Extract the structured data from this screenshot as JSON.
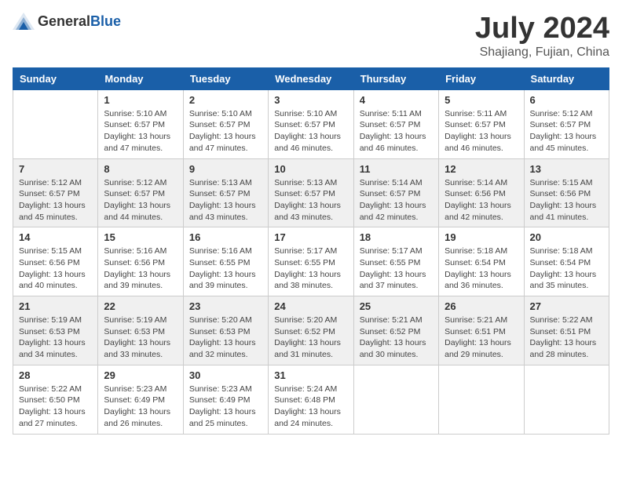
{
  "header": {
    "logo_general": "General",
    "logo_blue": "Blue",
    "main_title": "July 2024",
    "subtitle": "Shajiang, Fujian, China"
  },
  "weekdays": [
    "Sunday",
    "Monday",
    "Tuesday",
    "Wednesday",
    "Thursday",
    "Friday",
    "Saturday"
  ],
  "weeks": [
    [
      {
        "day": "",
        "sunrise": "",
        "sunset": "",
        "daylight": ""
      },
      {
        "day": "1",
        "sunrise": "Sunrise: 5:10 AM",
        "sunset": "Sunset: 6:57 PM",
        "daylight": "Daylight: 13 hours and 47 minutes."
      },
      {
        "day": "2",
        "sunrise": "Sunrise: 5:10 AM",
        "sunset": "Sunset: 6:57 PM",
        "daylight": "Daylight: 13 hours and 47 minutes."
      },
      {
        "day": "3",
        "sunrise": "Sunrise: 5:10 AM",
        "sunset": "Sunset: 6:57 PM",
        "daylight": "Daylight: 13 hours and 46 minutes."
      },
      {
        "day": "4",
        "sunrise": "Sunrise: 5:11 AM",
        "sunset": "Sunset: 6:57 PM",
        "daylight": "Daylight: 13 hours and 46 minutes."
      },
      {
        "day": "5",
        "sunrise": "Sunrise: 5:11 AM",
        "sunset": "Sunset: 6:57 PM",
        "daylight": "Daylight: 13 hours and 46 minutes."
      },
      {
        "day": "6",
        "sunrise": "Sunrise: 5:12 AM",
        "sunset": "Sunset: 6:57 PM",
        "daylight": "Daylight: 13 hours and 45 minutes."
      }
    ],
    [
      {
        "day": "7",
        "sunrise": "Sunrise: 5:12 AM",
        "sunset": "Sunset: 6:57 PM",
        "daylight": "Daylight: 13 hours and 45 minutes."
      },
      {
        "day": "8",
        "sunrise": "Sunrise: 5:12 AM",
        "sunset": "Sunset: 6:57 PM",
        "daylight": "Daylight: 13 hours and 44 minutes."
      },
      {
        "day": "9",
        "sunrise": "Sunrise: 5:13 AM",
        "sunset": "Sunset: 6:57 PM",
        "daylight": "Daylight: 13 hours and 43 minutes."
      },
      {
        "day": "10",
        "sunrise": "Sunrise: 5:13 AM",
        "sunset": "Sunset: 6:57 PM",
        "daylight": "Daylight: 13 hours and 43 minutes."
      },
      {
        "day": "11",
        "sunrise": "Sunrise: 5:14 AM",
        "sunset": "Sunset: 6:57 PM",
        "daylight": "Daylight: 13 hours and 42 minutes."
      },
      {
        "day": "12",
        "sunrise": "Sunrise: 5:14 AM",
        "sunset": "Sunset: 6:56 PM",
        "daylight": "Daylight: 13 hours and 42 minutes."
      },
      {
        "day": "13",
        "sunrise": "Sunrise: 5:15 AM",
        "sunset": "Sunset: 6:56 PM",
        "daylight": "Daylight: 13 hours and 41 minutes."
      }
    ],
    [
      {
        "day": "14",
        "sunrise": "Sunrise: 5:15 AM",
        "sunset": "Sunset: 6:56 PM",
        "daylight": "Daylight: 13 hours and 40 minutes."
      },
      {
        "day": "15",
        "sunrise": "Sunrise: 5:16 AM",
        "sunset": "Sunset: 6:56 PM",
        "daylight": "Daylight: 13 hours and 39 minutes."
      },
      {
        "day": "16",
        "sunrise": "Sunrise: 5:16 AM",
        "sunset": "Sunset: 6:55 PM",
        "daylight": "Daylight: 13 hours and 39 minutes."
      },
      {
        "day": "17",
        "sunrise": "Sunrise: 5:17 AM",
        "sunset": "Sunset: 6:55 PM",
        "daylight": "Daylight: 13 hours and 38 minutes."
      },
      {
        "day": "18",
        "sunrise": "Sunrise: 5:17 AM",
        "sunset": "Sunset: 6:55 PM",
        "daylight": "Daylight: 13 hours and 37 minutes."
      },
      {
        "day": "19",
        "sunrise": "Sunrise: 5:18 AM",
        "sunset": "Sunset: 6:54 PM",
        "daylight": "Daylight: 13 hours and 36 minutes."
      },
      {
        "day": "20",
        "sunrise": "Sunrise: 5:18 AM",
        "sunset": "Sunset: 6:54 PM",
        "daylight": "Daylight: 13 hours and 35 minutes."
      }
    ],
    [
      {
        "day": "21",
        "sunrise": "Sunrise: 5:19 AM",
        "sunset": "Sunset: 6:53 PM",
        "daylight": "Daylight: 13 hours and 34 minutes."
      },
      {
        "day": "22",
        "sunrise": "Sunrise: 5:19 AM",
        "sunset": "Sunset: 6:53 PM",
        "daylight": "Daylight: 13 hours and 33 minutes."
      },
      {
        "day": "23",
        "sunrise": "Sunrise: 5:20 AM",
        "sunset": "Sunset: 6:53 PM",
        "daylight": "Daylight: 13 hours and 32 minutes."
      },
      {
        "day": "24",
        "sunrise": "Sunrise: 5:20 AM",
        "sunset": "Sunset: 6:52 PM",
        "daylight": "Daylight: 13 hours and 31 minutes."
      },
      {
        "day": "25",
        "sunrise": "Sunrise: 5:21 AM",
        "sunset": "Sunset: 6:52 PM",
        "daylight": "Daylight: 13 hours and 30 minutes."
      },
      {
        "day": "26",
        "sunrise": "Sunrise: 5:21 AM",
        "sunset": "Sunset: 6:51 PM",
        "daylight": "Daylight: 13 hours and 29 minutes."
      },
      {
        "day": "27",
        "sunrise": "Sunrise: 5:22 AM",
        "sunset": "Sunset: 6:51 PM",
        "daylight": "Daylight: 13 hours and 28 minutes."
      }
    ],
    [
      {
        "day": "28",
        "sunrise": "Sunrise: 5:22 AM",
        "sunset": "Sunset: 6:50 PM",
        "daylight": "Daylight: 13 hours and 27 minutes."
      },
      {
        "day": "29",
        "sunrise": "Sunrise: 5:23 AM",
        "sunset": "Sunset: 6:49 PM",
        "daylight": "Daylight: 13 hours and 26 minutes."
      },
      {
        "day": "30",
        "sunrise": "Sunrise: 5:23 AM",
        "sunset": "Sunset: 6:49 PM",
        "daylight": "Daylight: 13 hours and 25 minutes."
      },
      {
        "day": "31",
        "sunrise": "Sunrise: 5:24 AM",
        "sunset": "Sunset: 6:48 PM",
        "daylight": "Daylight: 13 hours and 24 minutes."
      },
      {
        "day": "",
        "sunrise": "",
        "sunset": "",
        "daylight": ""
      },
      {
        "day": "",
        "sunrise": "",
        "sunset": "",
        "daylight": ""
      },
      {
        "day": "",
        "sunrise": "",
        "sunset": "",
        "daylight": ""
      }
    ]
  ]
}
